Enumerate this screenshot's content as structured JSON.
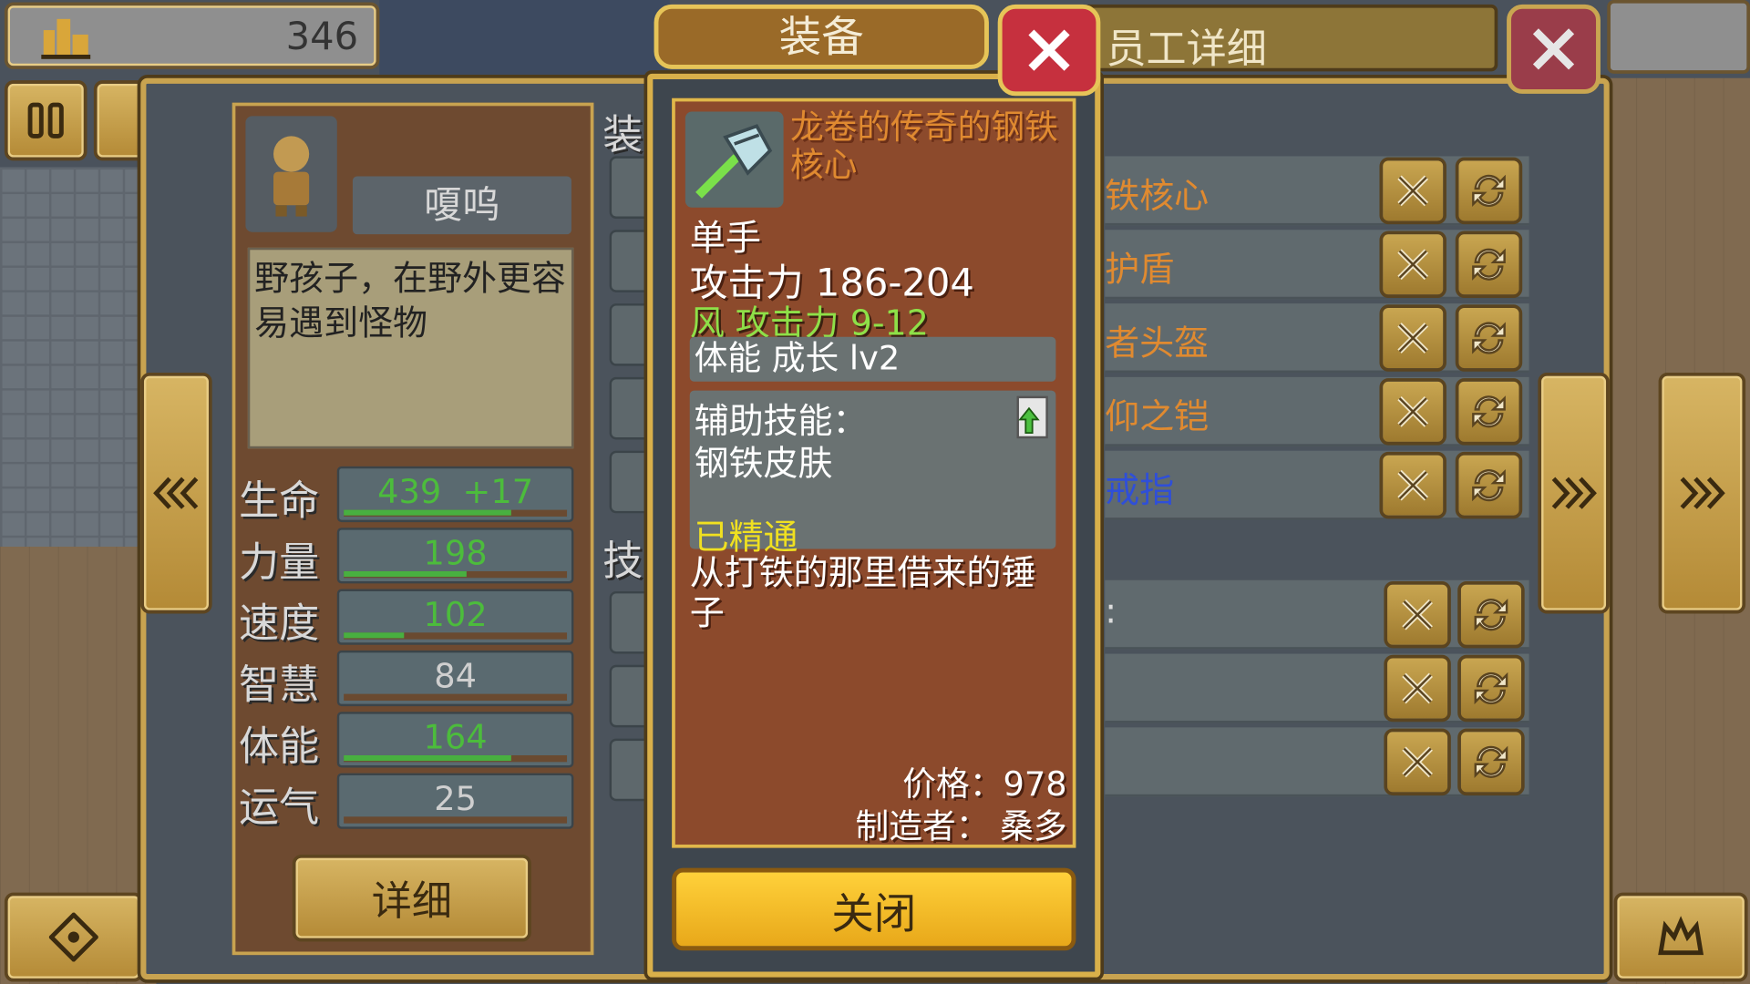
{
  "top_bar": {
    "score": "346"
  },
  "dialog_title": "装备",
  "employee_title": "员工详细",
  "character": {
    "name": "嗄呜",
    "description": "野孩子，在野外更容易遇到怪物",
    "stats": [
      {
        "label": "生命",
        "value": "439",
        "bonus": "+17",
        "color": "#4cbc3c",
        "fill": 0.75
      },
      {
        "label": "力量",
        "value": "198",
        "bonus": "",
        "color": "#4cbc3c",
        "fill": 0.55
      },
      {
        "label": "速度",
        "value": "102",
        "bonus": "",
        "color": "#4cbc3c",
        "fill": 0.27
      },
      {
        "label": "智慧",
        "value": "84",
        "bonus": "",
        "color": "#cfcfcf",
        "fill": 0.0
      },
      {
        "label": "体能",
        "value": "164",
        "bonus": "",
        "color": "#4cbc3c",
        "fill": 0.75
      },
      {
        "label": "运气",
        "value": "25",
        "bonus": "",
        "color": "#cfcfcf",
        "fill": 0.0
      }
    ],
    "detail_label": "详细"
  },
  "section_labels": {
    "equip": "装",
    "skill": "技"
  },
  "item": {
    "name": "龙卷的传奇的钢铁核心",
    "hand": "单手",
    "attack": "攻击力 186-204",
    "element": "风 攻击力 9-12",
    "growth": "体能 成长 lv2",
    "skill_title": "辅助技能：",
    "skill_name": "钢铁皮肤",
    "mastered": "已精通",
    "flavor": "从打铁的那里借来的锤子",
    "price": "价格：978",
    "maker": "制造者： 桑多",
    "close_label": "关闭"
  },
  "equipment_rows": [
    {
      "name": "铁核心",
      "color": "#e08a30"
    },
    {
      "name": "护盾",
      "color": "#e08a30"
    },
    {
      "name": "者头盔",
      "color": "#e08a30"
    },
    {
      "name": "仰之铠",
      "color": "#e08a30"
    },
    {
      "name": "戒指",
      "color": "#2f4fd8"
    }
  ],
  "skill_rows": [
    {
      "name": ":"
    },
    {
      "name": ""
    },
    {
      "name": ""
    }
  ],
  "colors": {
    "gold": "#c8a350",
    "item_bg": "#8c4a2c",
    "legend_name": "#e08a30",
    "wind": "#8ee048",
    "mastered": "#f0e020"
  },
  "icons": [
    "building-icon",
    "pause-icon",
    "dpad-icon",
    "crown-icon",
    "close-icon",
    "unequip-icon",
    "swap-icon",
    "hammer-icon",
    "skill-book-icon",
    "left-arrow-icon",
    "right-arrow-icon"
  ]
}
